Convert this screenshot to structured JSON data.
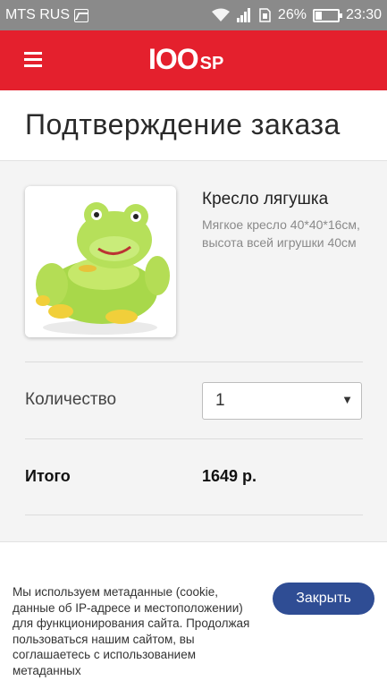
{
  "status_bar": {
    "carrier": "MTS RUS",
    "battery_percent": "26%",
    "time": "23:30"
  },
  "app": {
    "logo_big": "IOO",
    "logo_small": "SP"
  },
  "page": {
    "title": "Подтверждение заказа"
  },
  "product": {
    "name": "Кресло лягушка",
    "description": "Мягкое кресло 40*40*16см, высота всей игрушки 40см"
  },
  "quantity": {
    "label": "Количество",
    "value": "1"
  },
  "total": {
    "label": "Итого",
    "value": "1649 р."
  },
  "cookie_notice": {
    "text": "Мы используем метаданные (cookie, данные об IP-адресе и местоположении) для функционирования сайта. Продолжая пользоваться нашим сайтом, вы соглашаетесь с использованием метаданных",
    "close_label": "Закрыть"
  },
  "colors": {
    "brand_red": "#e4202d",
    "button_blue": "#2f4d94"
  }
}
